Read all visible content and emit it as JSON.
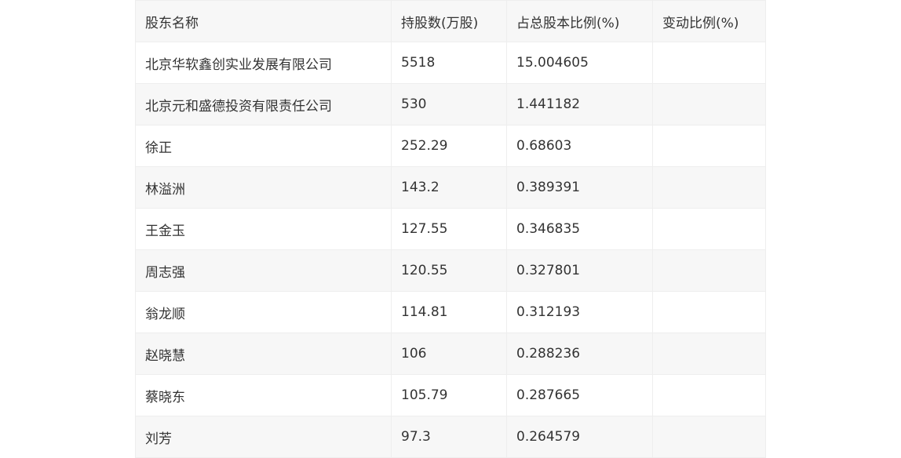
{
  "table": {
    "headers": [
      "股东名称",
      "持股数(万股)",
      "占总股本比例(%)",
      "变动比例(%)"
    ],
    "rows": [
      [
        "北京华软鑫创实业发展有限公司",
        "5518",
        "15.004605",
        ""
      ],
      [
        "北京元和盛德投资有限责任公司",
        "530",
        "1.441182",
        ""
      ],
      [
        "徐正",
        "252.29",
        "0.68603",
        ""
      ],
      [
        "林溢洲",
        "143.2",
        "0.389391",
        ""
      ],
      [
        "王金玉",
        "127.55",
        "0.346835",
        ""
      ],
      [
        "周志强",
        "120.55",
        "0.327801",
        ""
      ],
      [
        "翁龙顺",
        "114.81",
        "0.312193",
        ""
      ],
      [
        "赵晓慧",
        "106",
        "0.288236",
        ""
      ],
      [
        "蔡晓东",
        "105.79",
        "0.287665",
        ""
      ],
      [
        "刘芳",
        "97.3",
        "0.264579",
        ""
      ]
    ]
  }
}
